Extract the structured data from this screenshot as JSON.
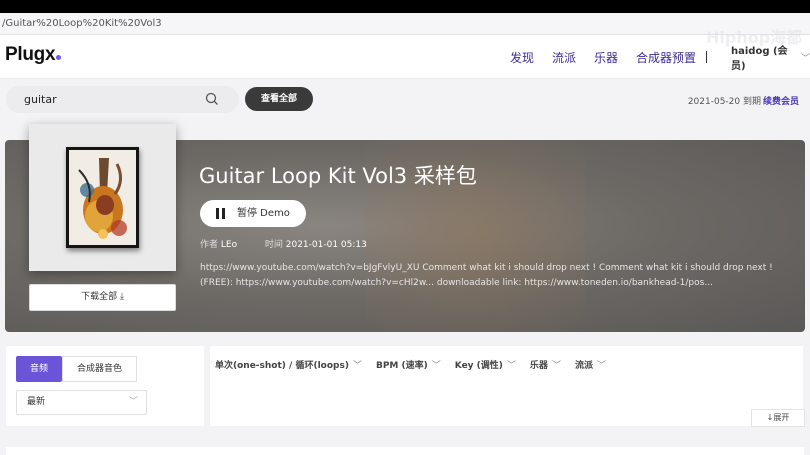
{
  "browser": {
    "url": "/Guitar%20Loop%20Kit%20Vol3"
  },
  "nav": {
    "logo": "Plugx",
    "links": [
      "发现",
      "流派",
      "乐器",
      "合成器预置"
    ],
    "user": "haidog (会员)",
    "watermark": "Hiphop海都"
  },
  "search": {
    "value": "guitar"
  },
  "view_all": "查看全部",
  "membership": {
    "date": "2021-05-20 到期",
    "renew": "续费会员"
  },
  "pack": {
    "title": "Guitar Loop Kit Vol3 采样包",
    "play_label": "暂停 Demo",
    "author_label": "作者",
    "author": "LEo",
    "time_label": "时间",
    "time": "2021-01-01 05:13",
    "desc_line1": "https://www.youtube.com/watch?v=bJgFvlyU_XU Comment what kit i should drop next ! Comment what kit i should drop next !",
    "desc_line2": "(FREE): https://www.youtube.com/watch?v=cHl2w... downloadable link: https://www.toneden.io/bankhead-1/pos...",
    "download_all": "下载全部"
  },
  "tabs": {
    "audio": "音频",
    "synth": "合成器音色"
  },
  "sort": {
    "selected": "最新"
  },
  "filters": [
    "单次(one-shot) / 循环(loops)",
    "BPM (速率)",
    "Key (调性)",
    "乐器",
    "流派"
  ],
  "expand": "展开",
  "colors": {
    "accent": "#6c54d9",
    "nav_link": "#3b2c91",
    "button_dark": "#3a3a3a"
  }
}
